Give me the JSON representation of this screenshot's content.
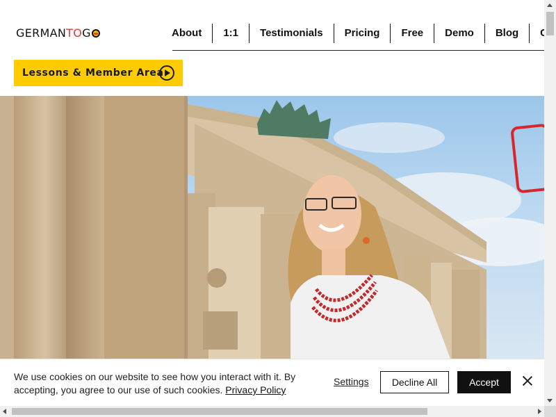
{
  "logo": {
    "part1": "GERMAN",
    "part2": "TO",
    "part3": "G"
  },
  "nav": {
    "items": [
      {
        "label": "About"
      },
      {
        "label": "1:1"
      },
      {
        "label": "Testimonials"
      },
      {
        "label": "Pricing"
      },
      {
        "label": "Free"
      },
      {
        "label": "Demo"
      },
      {
        "label": "Blog"
      },
      {
        "label": "Cont"
      }
    ]
  },
  "cta": {
    "label": "Lessons & Member Area",
    "icon": "play-circle-icon"
  },
  "hero": {
    "image": "brandenburg-gate-teacher-photo"
  },
  "cookie": {
    "text": "We use cookies on our website to see how you interact with it. By accepting, you agree to our use of such cookies.",
    "privacy_link": "Privacy Policy",
    "settings_label": "Settings",
    "decline_label": "Decline All",
    "accept_label": "Accept"
  },
  "colors": {
    "accent": "#ffcc00",
    "brand_red": "#e53935",
    "dark": "#111111"
  }
}
